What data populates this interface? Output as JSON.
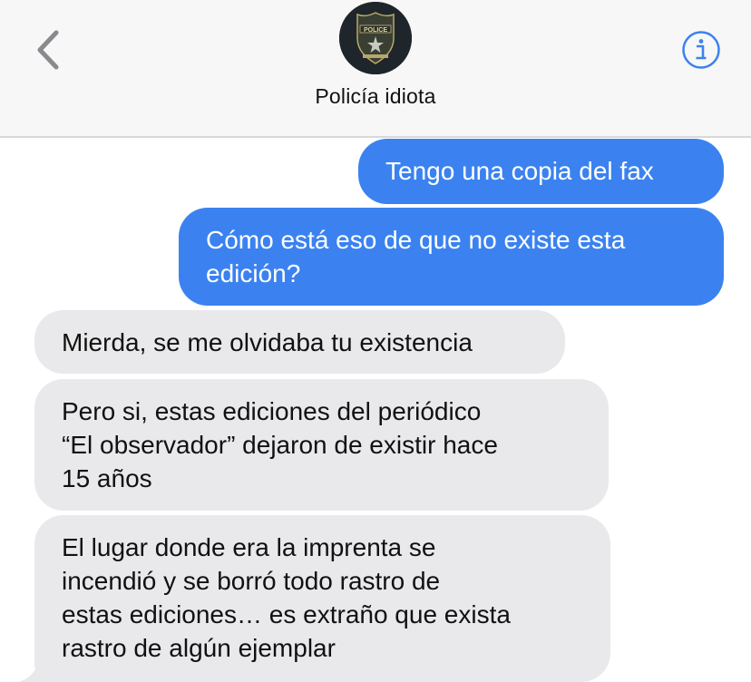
{
  "header": {
    "contact_name": "Policía idiota",
    "avatar_badge_text": "POLICE"
  },
  "messages": [
    {
      "direction": "outgoing",
      "text": "Tengo una copia del fax"
    },
    {
      "direction": "outgoing",
      "text": "Cómo está eso de que no existe esta\nedición?"
    },
    {
      "direction": "incoming",
      "text": "Mierda, se me olvidaba tu existencia"
    },
    {
      "direction": "incoming",
      "text": "Pero si, estas ediciones del periódico\n“El observador” dejaron de existir hace\n15 años"
    },
    {
      "direction": "incoming",
      "text": "El lugar donde era la imprenta se\nincendió y se borró todo rastro de\nestas ediciones… es extraño que exista\nrastro de algún ejemplar"
    }
  ],
  "colors": {
    "outgoing_bubble": "#3b82f0",
    "incoming_bubble": "#e9e9eb",
    "accent": "#3b82f0",
    "header_bg": "#f7f7f8"
  },
  "icons": {
    "back": "chevron-left-icon",
    "info": "info-circle-icon"
  }
}
